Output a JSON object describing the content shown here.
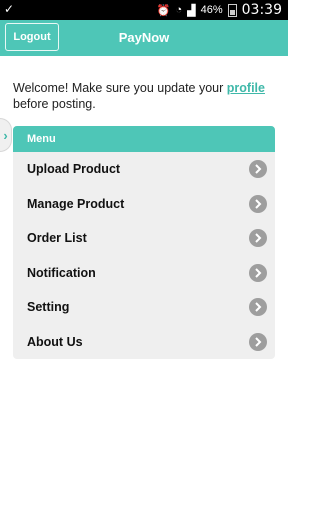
{
  "status_bar": {
    "battery_percent": "46%",
    "time": "03:39"
  },
  "header": {
    "logout_label": "Logout",
    "title": "PayNow"
  },
  "welcome": {
    "text_before": "Welcome! Make sure you update your ",
    "link": "profile",
    "text_after": " before posting."
  },
  "menu": {
    "title": "Menu",
    "items": [
      {
        "label": "Upload Product"
      },
      {
        "label": "Manage Product"
      },
      {
        "label": "Order List"
      },
      {
        "label": "Notification"
      },
      {
        "label": "Setting"
      },
      {
        "label": "About Us"
      }
    ]
  },
  "colors": {
    "accent": "#4ec6b7",
    "link": "#3fb8a9",
    "panel": "#efefef",
    "chevron": "#9e9e9e"
  }
}
